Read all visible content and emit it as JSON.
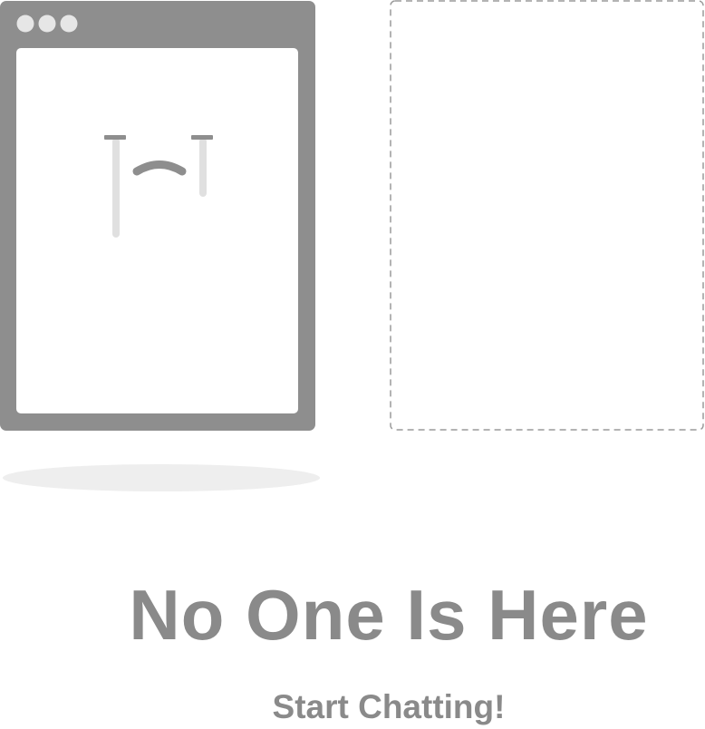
{
  "empty_state": {
    "title": "No One Is Here",
    "subtitle": "Start Chatting!"
  },
  "colors": {
    "window_frame": "#8e8e8e",
    "window_body": "#ffffff",
    "window_dots": "#e6e6e6",
    "face_light": "#e0e0e0",
    "face_dark": "#8e8e8e",
    "placeholder_border": "#9a9a9a",
    "shadow": "#eeeeee",
    "text": "#8a8a8a"
  },
  "icons": {
    "window": "browser-window-icon",
    "face": "sad-face-icon",
    "placeholder": "empty-placeholder-box"
  }
}
